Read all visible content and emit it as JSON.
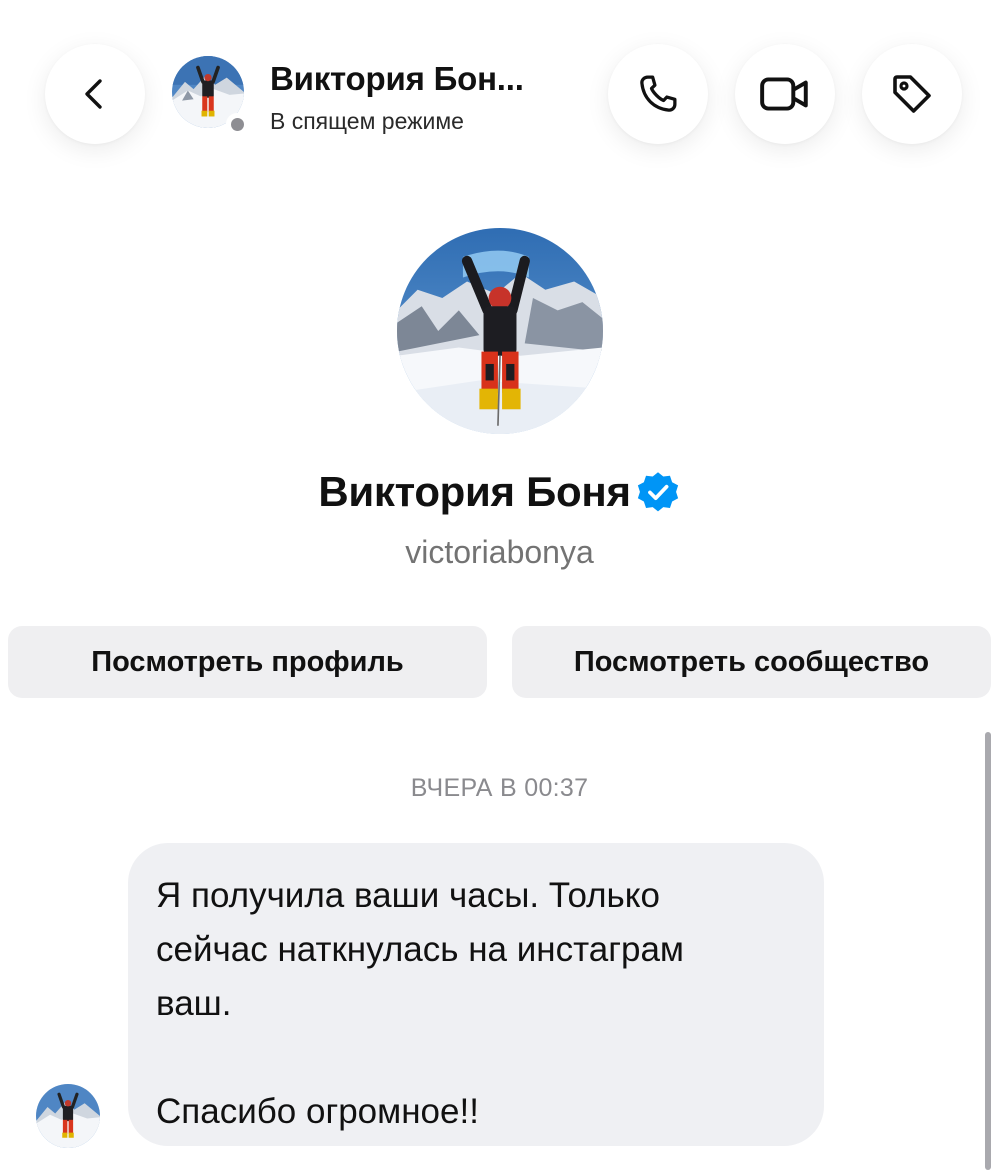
{
  "header": {
    "back_icon": "chevron-left-icon",
    "contact_name": "Виктория Бон...",
    "contact_status": "В спящем режиме",
    "call_icon": "phone-icon",
    "video_icon": "video-camera-icon",
    "label_icon": "tag-icon"
  },
  "profile": {
    "name": "Виктория Боня",
    "verified_icon": "verified-badge-icon",
    "username": "victoriabonya",
    "view_profile_label": "Посмотреть профиль",
    "view_community_label": "Посмотреть сообщество"
  },
  "chat": {
    "timestamp": "ВЧЕРА В 00:37",
    "message_lines": [
      "Я получила ваши часы. Только",
      "сейчас наткнулась на инстаграм",
      "ваш.",
      "",
      "Спасибо огромное!!"
    ]
  },
  "colors": {
    "verified_blue": "#0095f6",
    "bubble_bg": "#eff0f3",
    "button_bg": "#efeff1",
    "secondary_text": "#737373",
    "status_gray": "#8e8e93"
  }
}
